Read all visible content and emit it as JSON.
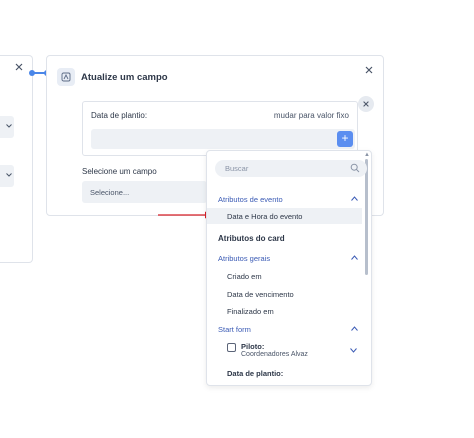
{
  "colors": {
    "accent": "#4a86e8",
    "section": "#3b5bb5",
    "field_bg": "#eef1f5",
    "arrow": "#d61f26"
  },
  "card": {
    "title": "Atualize um campo",
    "field_label": "Data de plantio:",
    "field_link": "mudar para valor fixo",
    "add_symbol": "+",
    "select_label": "Selecione um campo",
    "select_value": "Selecione..."
  },
  "dropdown": {
    "search_placeholder": "Buscar",
    "rows": [
      {
        "kind": "section",
        "label": "Atributos de evento",
        "expanded": true
      },
      {
        "kind": "item",
        "label": "Data e Hora do evento",
        "highlighted": true
      },
      {
        "kind": "group",
        "label": "Atributos do card"
      },
      {
        "kind": "section",
        "label": "Atributos gerais",
        "expanded": true
      },
      {
        "kind": "item",
        "label": "Criado em"
      },
      {
        "kind": "item",
        "label": "Data de vencimento"
      },
      {
        "kind": "item",
        "label": "Finalizado em"
      },
      {
        "kind": "section",
        "label": "Start form",
        "expanded": true
      }
    ],
    "piloto": {
      "label": "Piloto:",
      "sub": "Coordenadores Alvaz",
      "icon": "field-type-icon"
    },
    "last_item": "Data de plantio:"
  }
}
